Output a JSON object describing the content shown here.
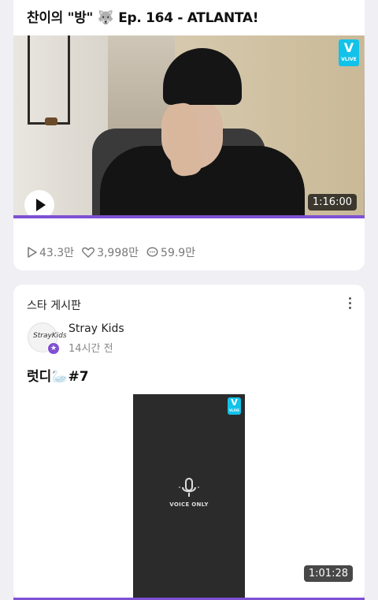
{
  "post1": {
    "title": "찬이의 \"방\" 🐺 Ep. 164 - ATLANTA!",
    "vlive_label": "VLIVE",
    "vlive_glyph": "V",
    "duration": "1:16:00",
    "watched_fraction": 1.0,
    "stats": {
      "plays": "43.3만",
      "likes": "3,998만",
      "comments": "59.9만"
    }
  },
  "post2": {
    "board_title": "스타 게시판",
    "author": "Stray Kids",
    "time": "14시간 전",
    "avatar_logo": "StrayKids",
    "title": "럿디🦢#7",
    "vlive_label": "VLIVE",
    "vlive_glyph": "V",
    "voice_only_label": "VOICE ONLY",
    "duration": "1:01:28",
    "watched_fraction": 1.0
  },
  "colors": {
    "accent": "#7f50d4",
    "vlive": "#12c2e9",
    "background": "#efeff4"
  },
  "icons": [
    "play-icon",
    "heart-icon",
    "comment-icon",
    "more-icon",
    "mic-icon",
    "star-badge-icon",
    "vlive-logo-icon"
  ]
}
